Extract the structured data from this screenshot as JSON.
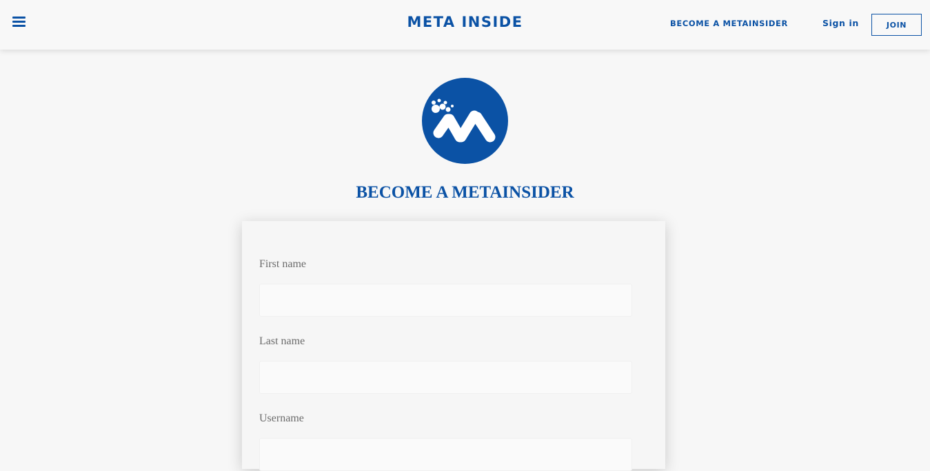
{
  "header": {
    "brand": "META INSIDE",
    "become_link": "BECOME A METAINSIDER",
    "signin_link": "Sign in",
    "join_button": "JOIN",
    "menu_icon": "hamburger-menu-icon"
  },
  "colors": {
    "accent": "#0b52a5",
    "background": "#f7f7f7",
    "label": "#6b6b6b"
  },
  "main": {
    "logo_icon": "meta-inside-logo-icon",
    "title": "BECOME A METAINSIDER"
  },
  "form": {
    "fields": [
      {
        "label": "First name",
        "value": "",
        "placeholder": ""
      },
      {
        "label": "Last name",
        "value": "",
        "placeholder": ""
      },
      {
        "label": "Username",
        "value": "",
        "placeholder": ""
      }
    ]
  }
}
